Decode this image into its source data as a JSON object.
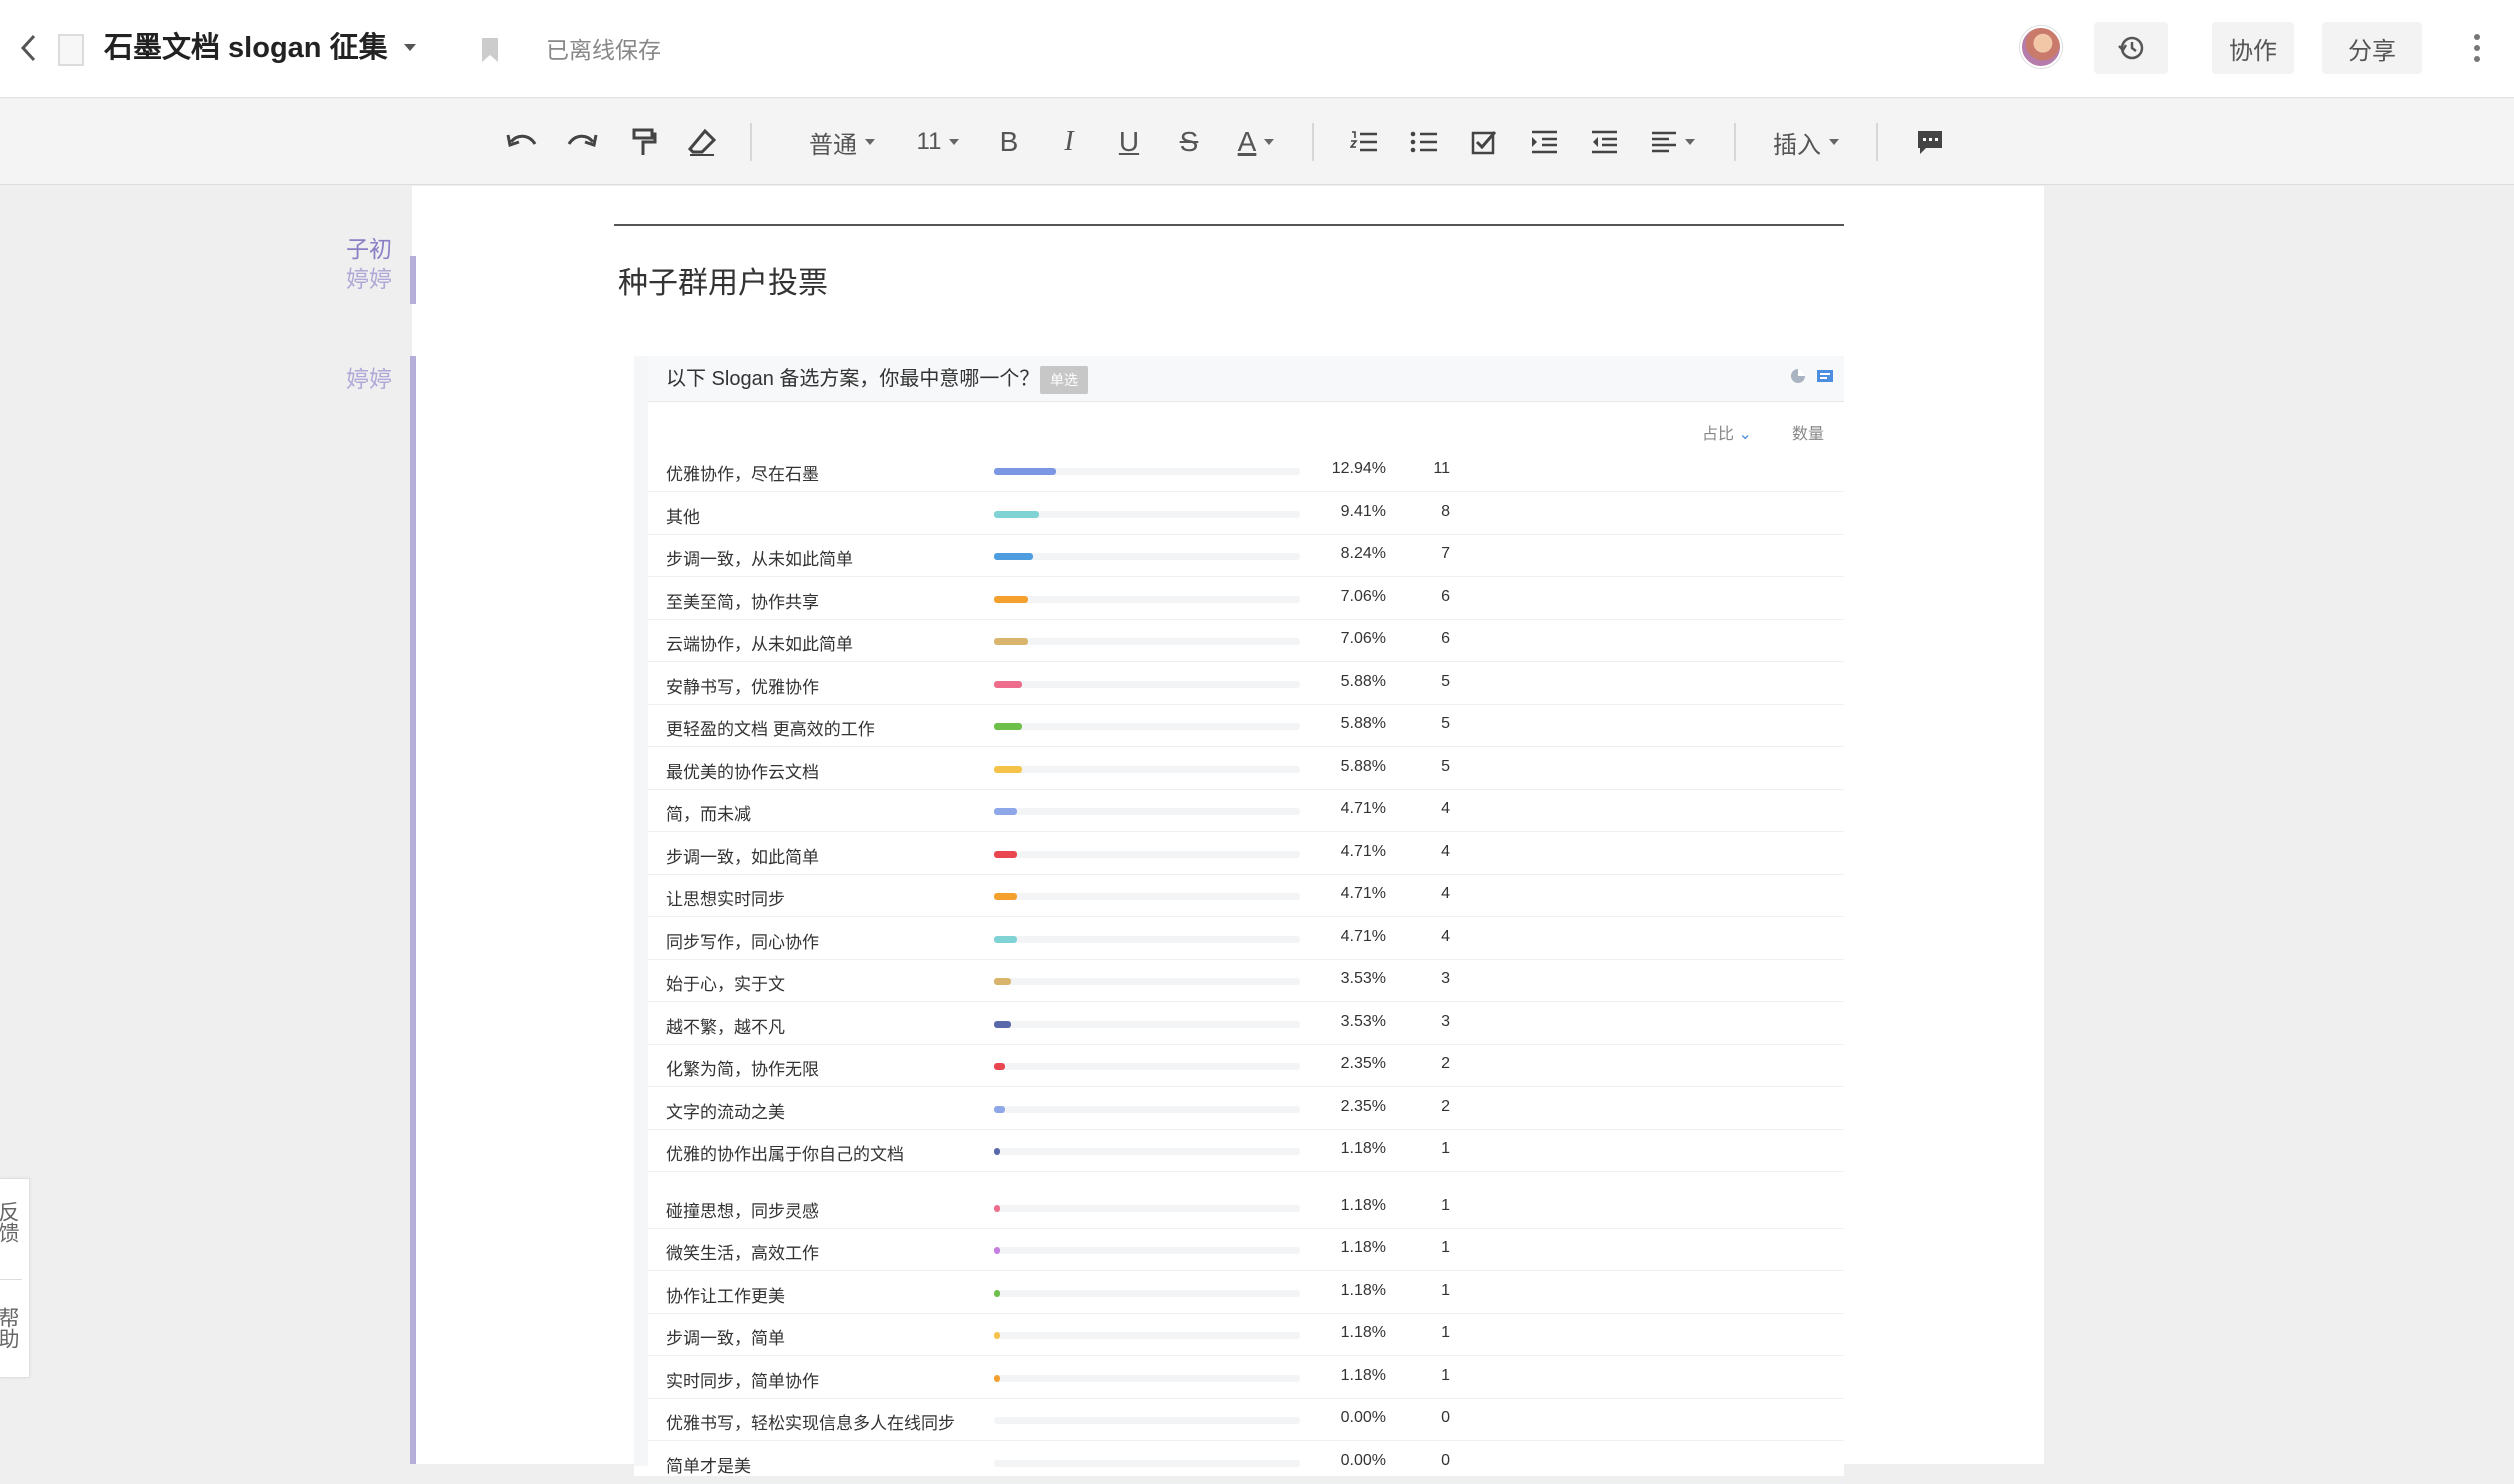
{
  "header": {
    "title": "石墨文档 slogan 征集",
    "save_status": "已离线保存",
    "collab_label": "协作",
    "share_label": "分享"
  },
  "toolbar": {
    "style_label": "普通",
    "size_label": "11",
    "insert_label": "插入"
  },
  "document": {
    "section_heading": "种子群用户投票"
  },
  "comments": [
    {
      "lines": [
        "子初",
        "婷婷"
      ]
    },
    {
      "lines": [
        "婷婷"
      ]
    }
  ],
  "poll": {
    "question": "以下 Slogan 备选方案，你最中意哪一个？",
    "tag": "单选",
    "col_pct": "占比",
    "col_count": "数量",
    "options": [
      {
        "label": "优雅协作，尽在石墨",
        "pct": "12.94%",
        "count": "11",
        "fraction": 0.1294,
        "color": "#7b96e3"
      },
      {
        "label": "其他",
        "pct": "9.41%",
        "count": "8",
        "fraction": 0.0941,
        "color": "#7fd3d4"
      },
      {
        "label": "步调一致，从未如此简单",
        "pct": "8.24%",
        "count": "7",
        "fraction": 0.0824,
        "color": "#4e9de1"
      },
      {
        "label": "至美至简，协作共享",
        "pct": "7.06%",
        "count": "6",
        "fraction": 0.0706,
        "color": "#f4a02f"
      },
      {
        "label": "云端协作，从未如此简单",
        "pct": "7.06%",
        "count": "6",
        "fraction": 0.0706,
        "color": "#d9b46d"
      },
      {
        "label": "安静书写，优雅协作",
        "pct": "5.88%",
        "count": "5",
        "fraction": 0.0588,
        "color": "#ee6d8c"
      },
      {
        "label": "更轻盈的文档 更高效的工作",
        "pct": "5.88%",
        "count": "5",
        "fraction": 0.0588,
        "color": "#6cc04a"
      },
      {
        "label": "最优美的协作云文档",
        "pct": "5.88%",
        "count": "5",
        "fraction": 0.0588,
        "color": "#f6c34a"
      },
      {
        "label": "简，而未减",
        "pct": "4.71%",
        "count": "4",
        "fraction": 0.0471,
        "color": "#8ea7e8"
      },
      {
        "label": "步调一致，如此简单",
        "pct": "4.71%",
        "count": "4",
        "fraction": 0.0471,
        "color": "#e94650"
      },
      {
        "label": "让思想实时同步",
        "pct": "4.71%",
        "count": "4",
        "fraction": 0.0471,
        "color": "#f4a02f"
      },
      {
        "label": "同步写作，同心协作",
        "pct": "4.71%",
        "count": "4",
        "fraction": 0.0471,
        "color": "#7fd3d4"
      },
      {
        "label": "始于心，实于文",
        "pct": "3.53%",
        "count": "3",
        "fraction": 0.0353,
        "color": "#d9b46d"
      },
      {
        "label": "越不繁，越不凡",
        "pct": "3.53%",
        "count": "3",
        "fraction": 0.0353,
        "color": "#5868a8"
      },
      {
        "label": "化繁为简，协作无限",
        "pct": "2.35%",
        "count": "2",
        "fraction": 0.0235,
        "color": "#e94650"
      },
      {
        "label": "文字的流动之美",
        "pct": "2.35%",
        "count": "2",
        "fraction": 0.0235,
        "color": "#8ea7e8"
      },
      {
        "label": "优雅的协作出属于你自己的文档",
        "pct": "1.18%",
        "count": "1",
        "fraction": 0.0118,
        "color": "#5868a8"
      },
      {
        "label": "碰撞思想，同步灵感",
        "pct": "1.18%",
        "count": "1",
        "fraction": 0.0118,
        "color": "#ee6d8c"
      },
      {
        "label": "微笑生活，高效工作",
        "pct": "1.18%",
        "count": "1",
        "fraction": 0.0118,
        "color": "#c67fe0"
      },
      {
        "label": "协作让工作更美",
        "pct": "1.18%",
        "count": "1",
        "fraction": 0.0118,
        "color": "#6cc04a"
      },
      {
        "label": "步调一致，简单",
        "pct": "1.18%",
        "count": "1",
        "fraction": 0.0118,
        "color": "#f6c34a"
      },
      {
        "label": "实时同步，简单协作",
        "pct": "1.18%",
        "count": "1",
        "fraction": 0.0118,
        "color": "#f4a02f"
      },
      {
        "label": "优雅书写，轻松实现信息多人在线同步",
        "pct": "0.00%",
        "count": "0",
        "fraction": 0,
        "color": "#cccccc"
      },
      {
        "label": "简单才是美",
        "pct": "0.00%",
        "count": "0",
        "fraction": 0,
        "color": "#cccccc"
      }
    ]
  },
  "feedback": {
    "feedback_label": "反馈",
    "help_label": "帮助"
  },
  "colors": {
    "accent": "#b5aed8",
    "comment_name": "#8b7fc6"
  }
}
